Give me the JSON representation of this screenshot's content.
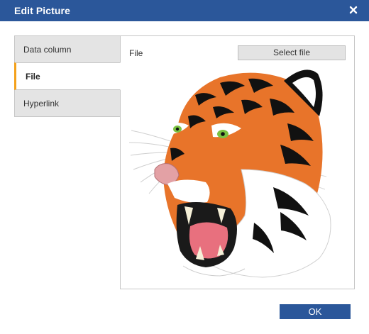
{
  "dialog": {
    "title": "Edit Picture",
    "close_icon": "close-icon"
  },
  "tabs": [
    {
      "label": "Data column",
      "active": false
    },
    {
      "label": "File",
      "active": true
    },
    {
      "label": "Hyperlink",
      "active": false
    }
  ],
  "file_panel": {
    "field_label": "File",
    "select_button_label": "Select file",
    "preview_image": "tiger-head-illustration"
  },
  "footer": {
    "ok_label": "OK"
  },
  "colors": {
    "titlebar": "#2b579a",
    "active_tab_accent": "#f4a11b",
    "ok_button": "#2b579a"
  }
}
